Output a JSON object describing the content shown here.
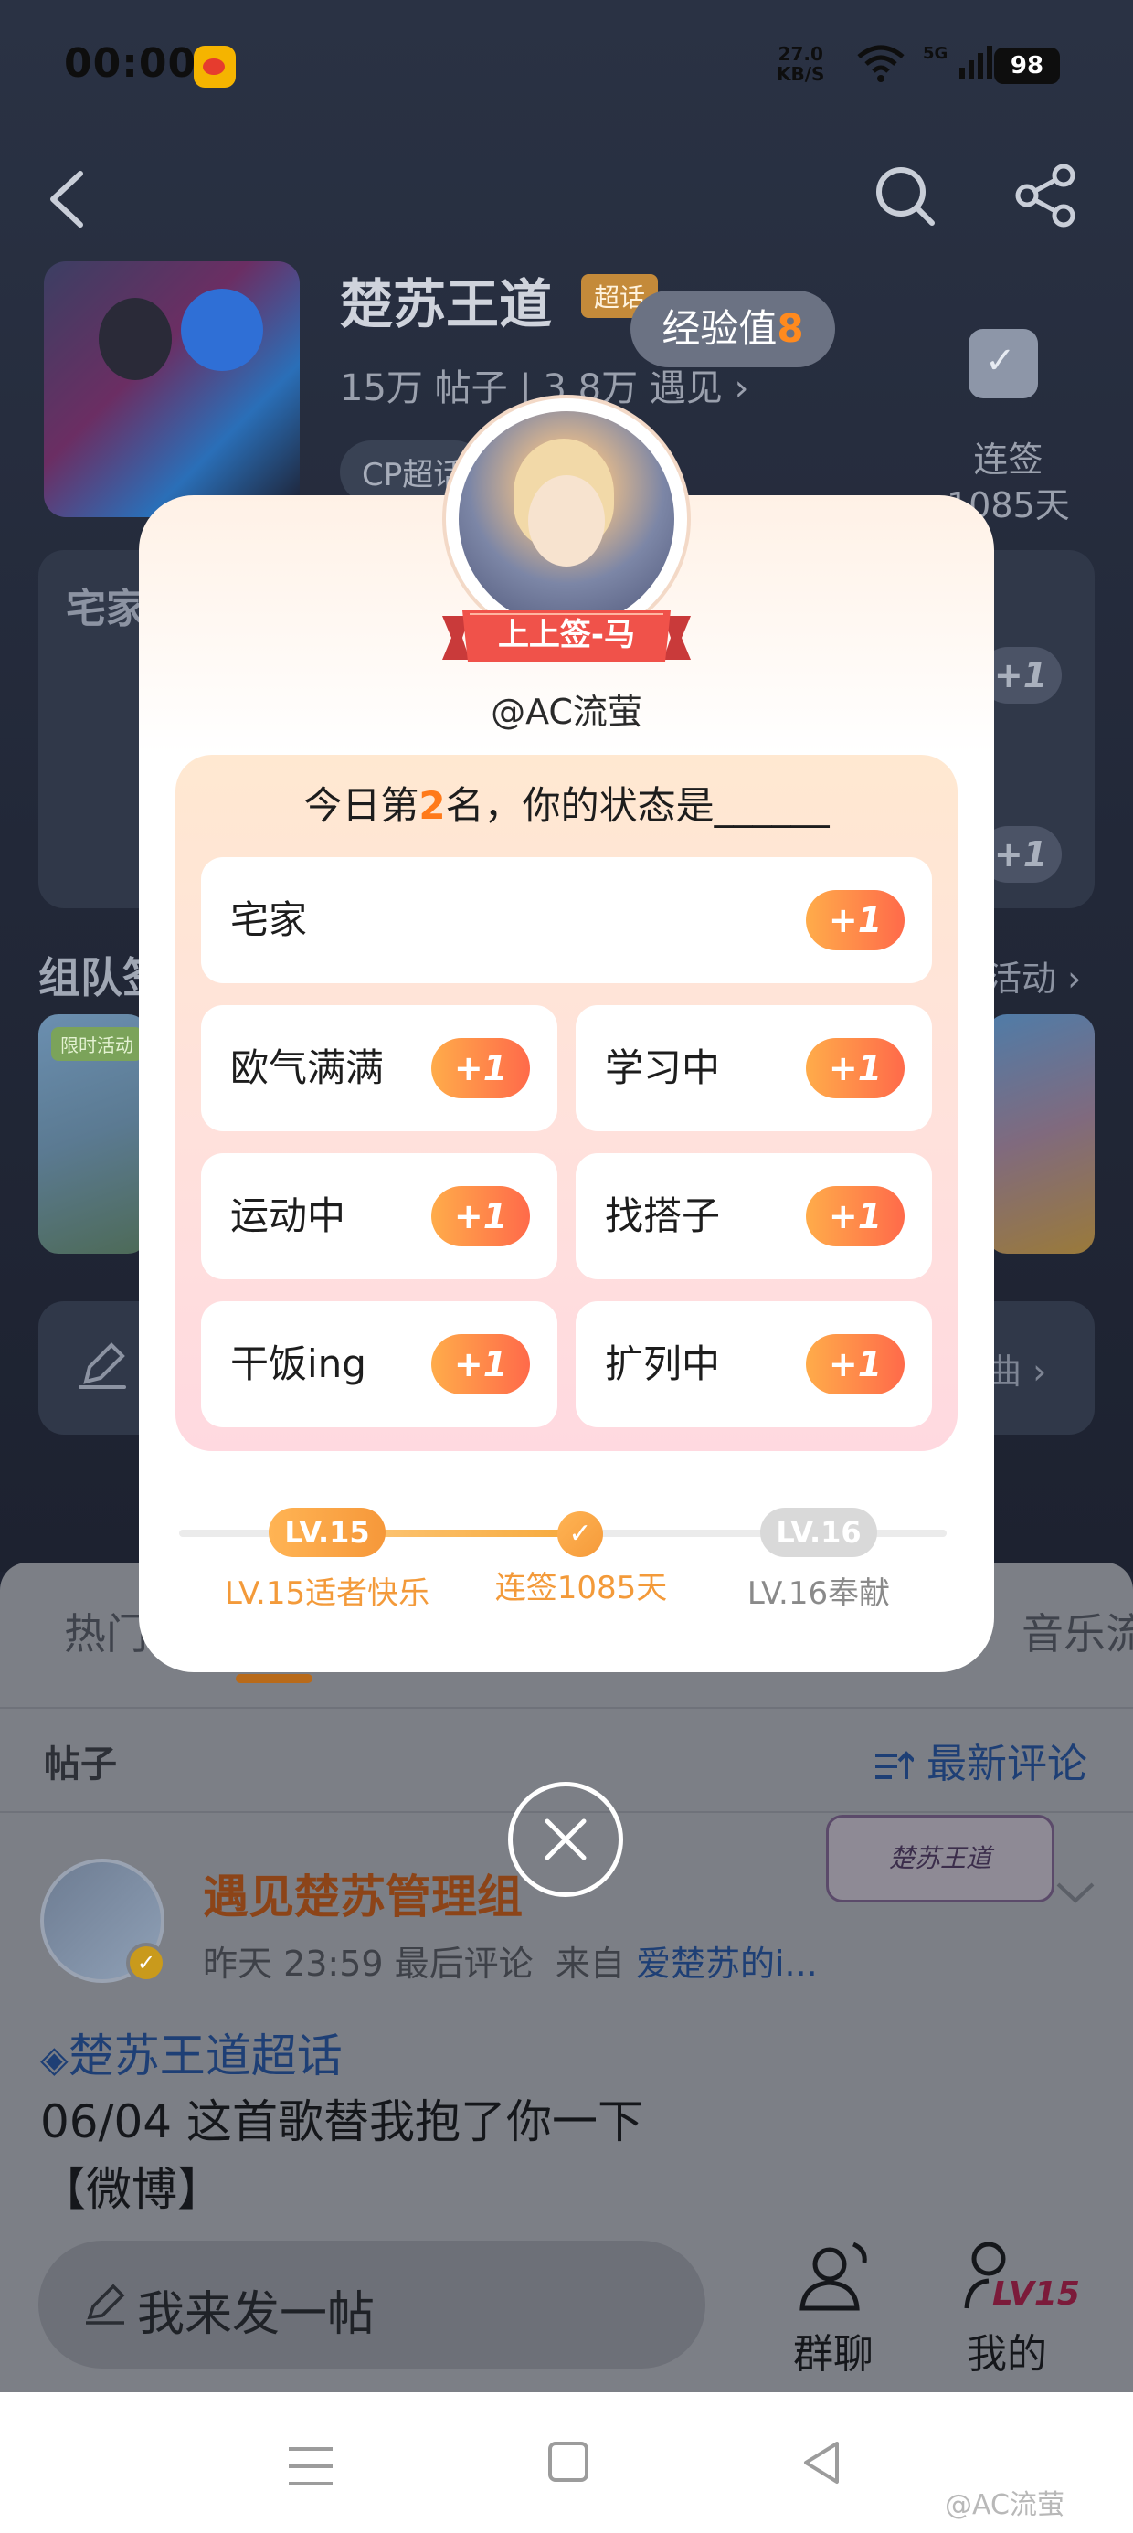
{
  "status_bar": {
    "time": "00:00",
    "speed_value": "27.0",
    "speed_unit": "KB/S",
    "signal": "5G",
    "battery": "98"
  },
  "topic": {
    "title": "楚苏王道",
    "badge": "超话",
    "stats": "15万 帖子 | 3.8万 遇见 ›",
    "cp_tag": "CP超话",
    "checkin_label": "连签",
    "checkin_days": "1085天"
  },
  "exp_pill": {
    "label": "经验值",
    "value": "8"
  },
  "background": {
    "status_panel_title": "宅家",
    "side_plus": "+1",
    "team_title": "组队签",
    "team_more": "活动 ›",
    "limited_tag": "限时活动",
    "tool_more": "曲 ›",
    "tabs": {
      "left": "热门",
      "right": "音乐流"
    },
    "posts_label": "帖子",
    "sort_label": "最新评论",
    "admin_name": "遇见楚苏管理组",
    "admin_time": "昨天 23:59 最后评论",
    "admin_from_prefix": "来自",
    "admin_from_link": "爱楚苏的i...",
    "sticker_text": "楚苏王道",
    "hashtag": "楚苏王道超话",
    "post_line1": "06/04 这首歌替我抱了你一下",
    "post_line2": "【微博】",
    "compose_placeholder": "我来发一帖",
    "group_chat": "群聊",
    "mine": "我的",
    "mine_level": "LV15",
    "watermark": "@AC流萤"
  },
  "modal": {
    "ribbon": "上上签-马",
    "username": "@AC流萤",
    "question_prefix": "今日第",
    "rank": "2",
    "question_suffix": "名，你的状态是______",
    "plus_label": "+1",
    "options": [
      {
        "label": "宅家"
      },
      {
        "label": "欧气满满"
      },
      {
        "label": "学习中"
      },
      {
        "label": "运动中"
      },
      {
        "label": "找搭子"
      },
      {
        "label": "干饭ing"
      },
      {
        "label": "扩列中"
      }
    ],
    "progress": {
      "current_level": "LV.15",
      "next_level": "LV.16",
      "current_title": "LV.15适者快乐",
      "streak": "连签1085天",
      "next_title": "LV.16奉献"
    }
  },
  "colors": {
    "accent": "#ff7a1a",
    "plus_start": "#ffac4a",
    "plus_end": "#ff6a4a",
    "ribbon": "#f0524a"
  }
}
